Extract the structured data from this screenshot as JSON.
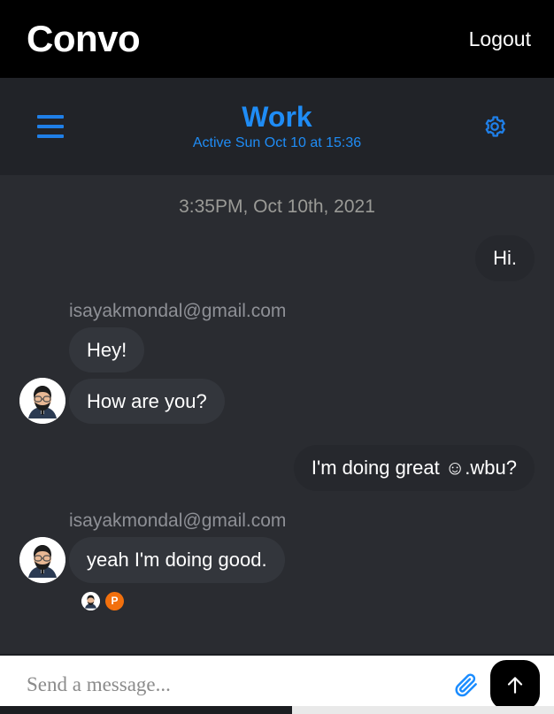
{
  "topbar": {
    "brand": "Convo",
    "logout_label": "Logout"
  },
  "conversation_header": {
    "menu_icon": "hamburger-menu-icon",
    "title": "Work",
    "status": "Active Sun Oct 10 at 15:36",
    "settings_icon": "gear-icon",
    "accent_color": "#1f8cf5"
  },
  "chat": {
    "day_stamp": "3:35PM, Oct 10th, 2021",
    "messages": [
      {
        "id": "m1",
        "direction": "out",
        "text": "Hi.",
        "sender_label": "",
        "avatar": false
      },
      {
        "id": "m2",
        "direction": "in",
        "text": "Hey!",
        "sender_label": "isayakmondal@gmail.com",
        "avatar": false
      },
      {
        "id": "m3",
        "direction": "in",
        "text": "How are you?",
        "sender_label": "",
        "avatar": true
      },
      {
        "id": "m4",
        "direction": "out",
        "text": "I'm doing great ☺.wbu?",
        "sender_label": "",
        "avatar": false
      },
      {
        "id": "m5",
        "direction": "in",
        "text": "yeah I'm doing good.",
        "sender_label": "isayakmondal@gmail.com",
        "avatar": true
      }
    ],
    "read_receipts": [
      {
        "type": "avatar",
        "name": "reader-avatar"
      },
      {
        "type": "initial",
        "label": "P",
        "color": "#f2700d"
      }
    ]
  },
  "composer": {
    "placeholder": "Send a message...",
    "value": "",
    "attach_icon": "paperclip-icon",
    "send_icon": "arrow-up-icon",
    "attach_color": "#1a8cff"
  }
}
